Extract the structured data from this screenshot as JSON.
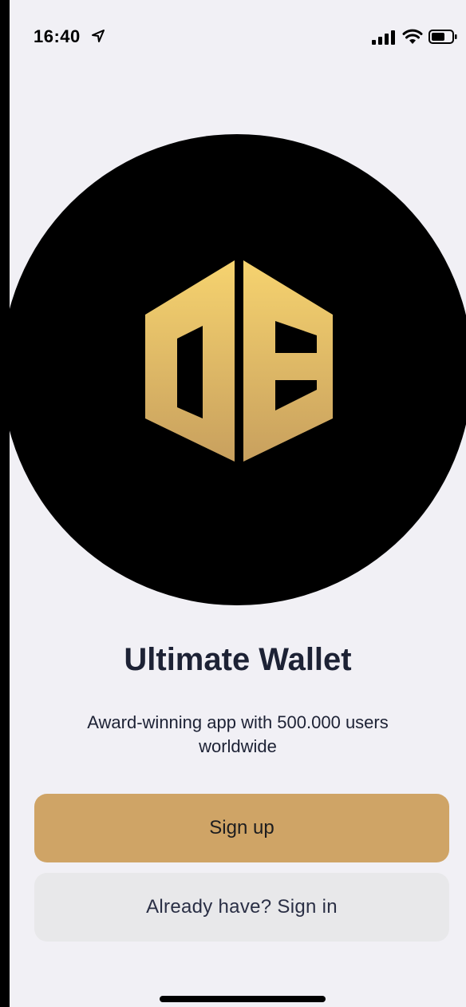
{
  "status_bar": {
    "time": "16:40",
    "icons": [
      "location-arrow-icon",
      "cellular-signal-icon",
      "wifi-icon",
      "battery-icon"
    ]
  },
  "hero": {
    "logo": "ultimate-wallet-logo",
    "circle_color": "#000000",
    "logo_gradient": [
      "#f6d36f",
      "#c8a05e"
    ]
  },
  "title": "Ultimate Wallet",
  "subtitle": "Award-winning app with 500.000 users worldwide",
  "buttons": {
    "signup_label": "Sign up",
    "signin_label": "Already have? Sign in"
  },
  "colors": {
    "background": "#f1f0f5",
    "primary_button": "#cfa466",
    "secondary_button": "#e8e8ea",
    "text_dark": "#1d2235"
  }
}
